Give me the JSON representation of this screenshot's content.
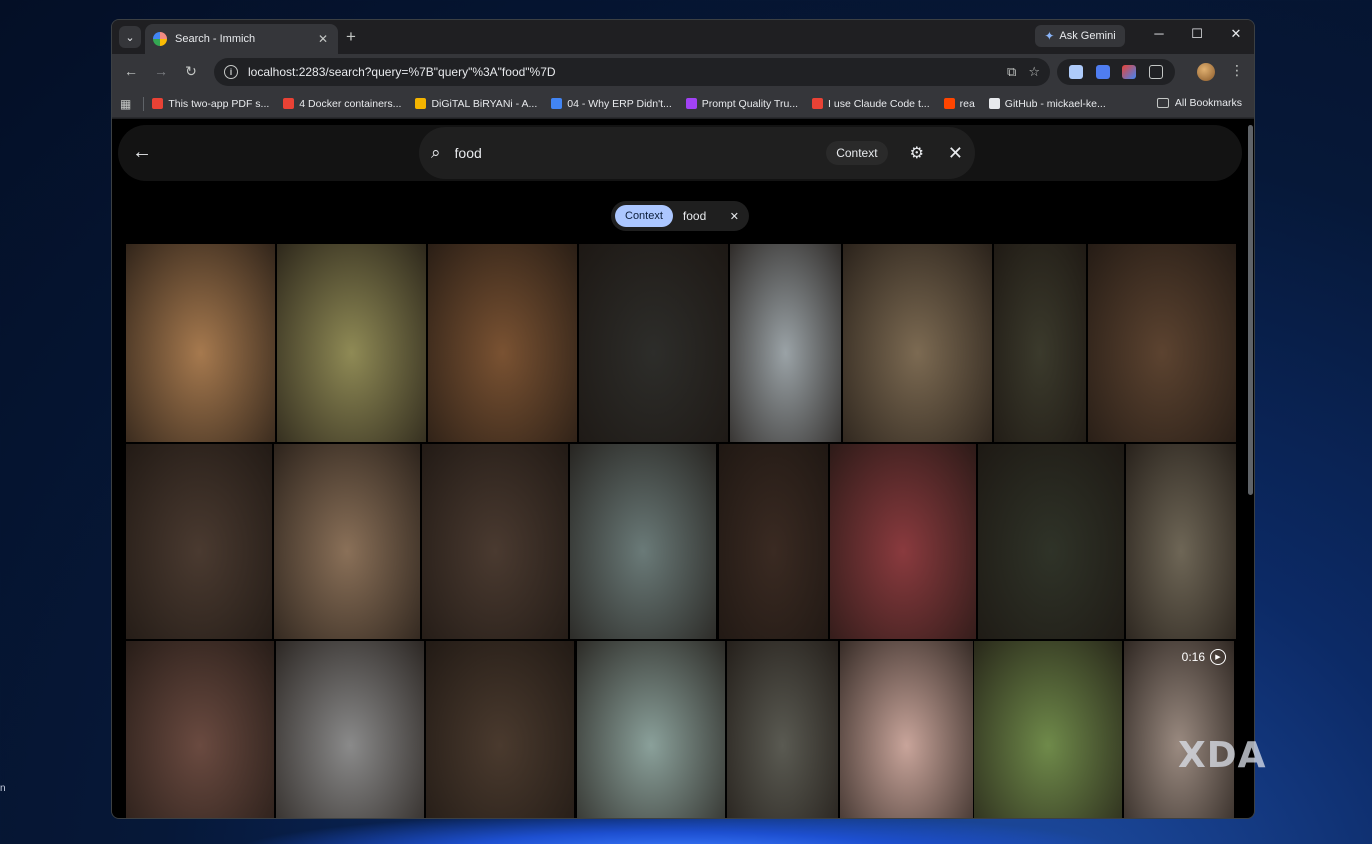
{
  "desktop": {
    "side_text": "n",
    "watermark": "XDA"
  },
  "browser": {
    "tab": {
      "title": "Search - Immich"
    },
    "gemini_label": "Ask Gemini",
    "url": "localhost:2283/search?query=%7B\"query\"%3A\"food\"%7D",
    "bookmarks": [
      {
        "label": "This two-app PDF s...",
        "color": "#e94235"
      },
      {
        "label": "4 Docker containers...",
        "color": "#e94235"
      },
      {
        "label": "DiGiTAL BiRYANi - A...",
        "color": "#f4b400"
      },
      {
        "label": "04 - Why ERP Didn't...",
        "color": "#4285f4"
      },
      {
        "label": "Prompt Quality Tru...",
        "color": "#a142f4"
      },
      {
        "label": "I use Claude Code t...",
        "color": "#e94235"
      },
      {
        "label": "rea",
        "color": "#ff4500"
      },
      {
        "label": "GitHub - mickael-ke...",
        "color": "#e8eaed"
      }
    ],
    "all_bookmarks": "All Bookmarks"
  },
  "app": {
    "search": {
      "value": "food",
      "type_chip": "Context"
    },
    "filter": {
      "type": "Context",
      "value": "food"
    },
    "photos": [
      {
        "color": "#a6794e"
      },
      {
        "color": "#8f8a55"
      },
      {
        "color": "#7a5232"
      },
      {
        "color": "#2d2d2a"
      },
      {
        "color": "#9aa2a6"
      },
      {
        "color": "#7c6a52"
      },
      {
        "color": "#3b3a2c"
      },
      {
        "color": "#5c4330"
      },
      {
        "color": "#4a3a30"
      },
      {
        "color": "#8a7058"
      },
      {
        "color": "#4a3a30"
      },
      {
        "color": "#6a7a78"
      },
      {
        "color": "#3a2a22"
      },
      {
        "color": "#8a3a3e"
      },
      {
        "color": "#2f3328"
      },
      {
        "color": "#6e6656"
      },
      {
        "color": "#6a4a40"
      },
      {
        "color": "#8a8a8a"
      },
      {
        "color": "#4a3a2e"
      },
      {
        "color": "#8aa09a"
      },
      {
        "color": "#5a5a52"
      },
      {
        "color": "#c8a49a"
      },
      {
        "color": "#6f8a4a"
      },
      {
        "color": "#9a8a80",
        "duration": "0:16"
      }
    ]
  }
}
